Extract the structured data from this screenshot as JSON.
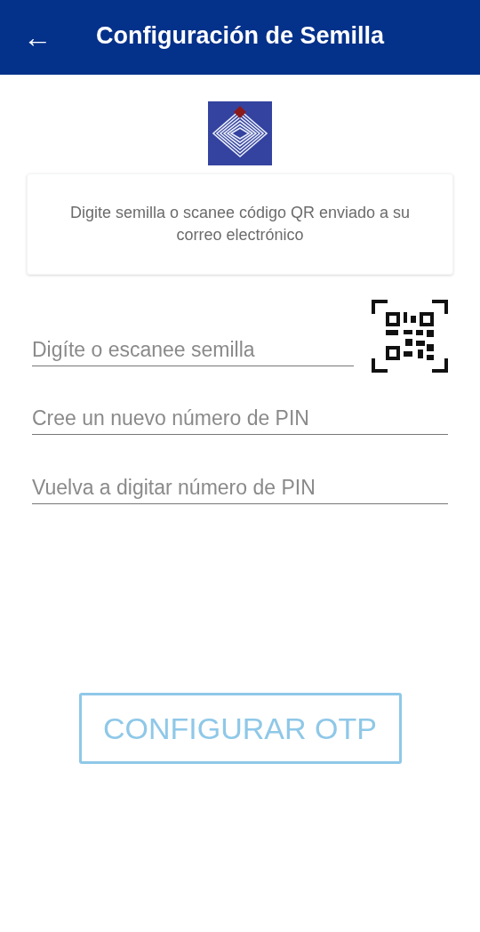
{
  "app_bar": {
    "back_icon": "←",
    "title": "Configuración de Semilla"
  },
  "info_card": {
    "text": "Digite semilla o scanee código QR enviado a su correo electrónico"
  },
  "fields": [
    {
      "placeholder": "Digíte o escanee semilla",
      "kind": "qr"
    },
    {
      "placeholder": "Cree un nuevo número de PIN",
      "kind": "plain"
    },
    {
      "placeholder": "Vuelva a digitar número de PIN",
      "kind": "plain"
    }
  ],
  "submit_button": {
    "label": "CONFIGURAR OTP",
    "disabled": true
  }
}
